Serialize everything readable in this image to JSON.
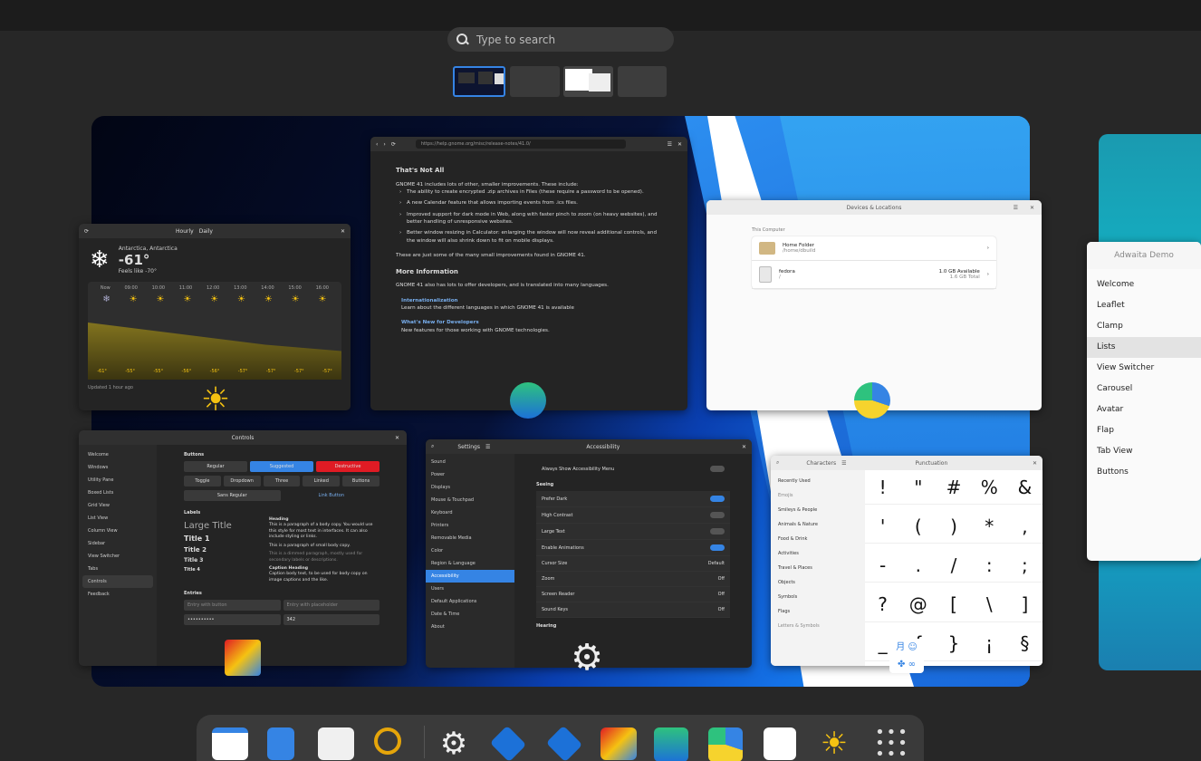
{
  "search": {
    "placeholder": "Type to search"
  },
  "weather": {
    "tab_hourly": "Hourly",
    "tab_daily": "Daily",
    "location": "Antarctica, Antarctica",
    "temperature": "-61°",
    "feels_like": "Feels like -70°",
    "times": [
      "Now",
      "09:00",
      "10:00",
      "11:00",
      "12:00",
      "13:00",
      "14:00",
      "15:00",
      "16:00"
    ],
    "temps": [
      "-61°",
      "-55°",
      "-55°",
      "-56°",
      "-56°",
      "-57°",
      "-57°",
      "-57°",
      "-57°"
    ],
    "footer": "Updated 1 hour ago"
  },
  "browser": {
    "url": "https://help.gnome.org/misc/release-notes/41.0/",
    "h1": "That's Not All",
    "intro": "GNOME 41 includes lots of other, smaller improvements. These include:",
    "items": [
      "The ability to create encrypted .zip archives in Files (these require a password to be opened).",
      "A new Calendar feature that allows importing events from .ics files.",
      "Improved support for dark mode in Web, along with faster pinch to zoom (on heavy websites), and better handling of unresponsive websites.",
      "Better window resizing in Calculator: enlarging the window will now reveal additional controls, and the window will also shrink down to fit on mobile displays."
    ],
    "outro": "These are just some of the many small improvements found in GNOME 41.",
    "h2": "More Information",
    "more": "GNOME 41 also has lots to offer developers, and is translated into many languages.",
    "link1": "Internationalization",
    "link1_desc": "Learn about the different languages in which GNOME 41 is available",
    "link2": "What's New for Developers",
    "link2_desc": "New features for those working with GNOME technologies."
  },
  "files": {
    "title": "Devices & Locations",
    "section": "This Computer",
    "home_name": "Home Folder",
    "home_path": "/home/dbuild",
    "drive_name": "fedora",
    "drive_path": "/",
    "drive_available": "1.0 GB Available",
    "drive_total": "1.6 GB Total"
  },
  "controls": {
    "title": "Controls",
    "sidebar": [
      "Welcome",
      "Windows",
      "Utility Pane",
      "Boxed Lists",
      "Grid View",
      "List View",
      "Column View",
      "Sidebar",
      "View Switcher",
      "Tabs",
      "Controls",
      "Feedback"
    ],
    "buttons_heading": "Buttons",
    "row1": [
      "Regular",
      "Suggested",
      "Destructive"
    ],
    "row2": [
      "Toggle",
      "Dropdown",
      "Three",
      "Linked",
      "Buttons"
    ],
    "row3": [
      "Sans Regular",
      "Link Button"
    ],
    "labels_heading": "Labels",
    "large_title": "Large Title",
    "title1": "Title 1",
    "title2": "Title 2",
    "title3": "Title 3",
    "title4": "Title 4",
    "heading": "Heading",
    "body": "This is a paragraph of a body copy. You would use this style for most text in interfaces. It can also include styling or links.",
    "small": "This is a paragraph of small body copy.",
    "dimmed": "This is a dimmed paragraph, mostly used for secondary labels or descriptions.",
    "caption_heading": "Caption Heading",
    "caption": "Caption body text, to be used for body copy on image captions and the like.",
    "entries_heading": "Entries",
    "entry1_placeholder": "Entry with button",
    "entry2_placeholder": "Entry with placeholder",
    "spin_value": "342"
  },
  "settings": {
    "title": "Settings",
    "panel_title": "Accessibility",
    "sidebar": [
      "Sound",
      "Power",
      "Displays",
      "Mouse & Touchpad",
      "Keyboard",
      "Printers",
      "Removable Media",
      "Color",
      "Region & Language",
      "Accessibility",
      "Users",
      "Default Applications",
      "Date & Time",
      "About"
    ],
    "always_show": "Always Show Accessibility Menu",
    "seeing": "Seeing",
    "rows": [
      {
        "label": "Prefer Dark",
        "value": ""
      },
      {
        "label": "High Contrast",
        "value": ""
      },
      {
        "label": "Large Text",
        "value": ""
      },
      {
        "label": "Enable Animations",
        "value": ""
      },
      {
        "label": "Cursor Size",
        "value": "Default"
      },
      {
        "label": "Zoom",
        "value": "Off"
      },
      {
        "label": "Screen Reader",
        "value": "Off"
      },
      {
        "label": "Sound Keys",
        "value": "Off"
      }
    ],
    "hearing": "Hearing"
  },
  "characters": {
    "title": "Characters",
    "panel_title": "Punctuation",
    "recent": "Recently Used",
    "emoji_heading": "Emojis",
    "categories": [
      "Smileys & People",
      "Animals & Nature",
      "Food & Drink",
      "Activities",
      "Travel & Places",
      "Objects",
      "Symbols",
      "Flags"
    ],
    "letters_heading": "Letters & Symbols",
    "glyphs": [
      "!",
      "\"",
      "#",
      "%",
      "&",
      "'",
      "(",
      ")",
      "*",
      ",",
      "-",
      ".",
      "/",
      ":",
      ";",
      "?",
      "@",
      "[",
      "\\",
      "]",
      "_",
      "{",
      "}",
      "¡",
      "§"
    ]
  },
  "adwaita": {
    "title": "Adwaita Demo",
    "items": [
      "Welcome",
      "Leaflet",
      "Clamp",
      "Lists",
      "View Switcher",
      "Carousel",
      "Avatar",
      "Flap",
      "Tab View",
      "Buttons"
    ],
    "selected_index": 3
  },
  "dock": {
    "apps": [
      "calendar-icon",
      "text-editor-icon",
      "software-icon",
      "builder-icon",
      "settings-icon",
      "inkscape-icon",
      "inkscape-icon",
      "fragments-icon",
      "web-icon",
      "disk-usage-icon",
      "characters-icon",
      "weather-icon",
      "app-grid-icon"
    ]
  }
}
